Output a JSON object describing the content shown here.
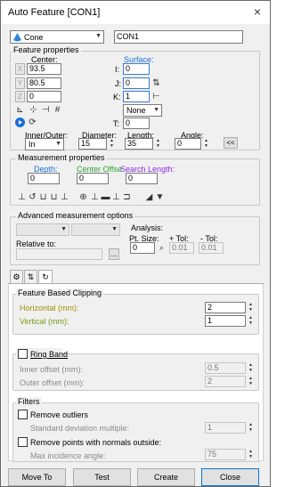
{
  "window": {
    "title": "Auto Feature [CON1]",
    "close_glyph": "×"
  },
  "feature": {
    "type": "Cone",
    "name": "CON1"
  },
  "props": {
    "legend": "Feature properties",
    "center_label": "Center:",
    "surface_label": "Surface:",
    "x_axis": "X",
    "y_axis": "Y",
    "z_axis": "Z",
    "x": "93.5",
    "y": "80.5",
    "z": "0",
    "i_label": "I:",
    "j_label": "J:",
    "k_label": "K:",
    "t_label": "T:",
    "i": "0",
    "j": "0",
    "k": "1",
    "t": "0",
    "none_select": "None",
    "inout_label": "Inner/Outer:",
    "inout_value": "In",
    "diameter_label": "Diameter:",
    "diameter": "15",
    "length_label": "Length:",
    "length": "35",
    "angle_label": "Angle:",
    "angle": "0",
    "collapse_btn": "<<"
  },
  "meas": {
    "legend": "Measurement properties",
    "depth_label": "Depth:",
    "depth": "0",
    "center_offset_label": "Center Offse",
    "center_offset": "0",
    "search_length_label": "Search Length:",
    "search_length": "0"
  },
  "adv": {
    "legend": "Advanced measurement options",
    "analysis_label": "Analysis:",
    "ptsize_label": "Pt. Size:",
    "ptsize": "0",
    "plus_tol_label": "+ Tol:",
    "plus_tol": "0.01",
    "minus_tol_label": "- Tol:",
    "minus_tol": "0.01",
    "relative_label": "Relative to:",
    "browse_btn": "..."
  },
  "clip": {
    "legend": "Feature Based Clipping",
    "horizontal_label": "Horizontal (mm):",
    "horizontal": "2",
    "vertical_label": "Vertical (mm):",
    "vertical": "1"
  },
  "ring": {
    "label": "Ring Band",
    "inner_label": "Inner offset (mm):",
    "inner": "0.5",
    "outer_label": "Outer offset (mm):",
    "outer": "2"
  },
  "filters": {
    "legend": "Filters",
    "remove_outliers": "Remove outliers",
    "std_label": "Standard deviation multiple:",
    "std": "1",
    "remove_normals": "Remove points with normals outside:",
    "max_angle_label": "Max incidence angle:",
    "max_angle": "75"
  },
  "buttons": {
    "move_to": "Move To",
    "test": "Test",
    "create": "Create",
    "close": "Close"
  }
}
